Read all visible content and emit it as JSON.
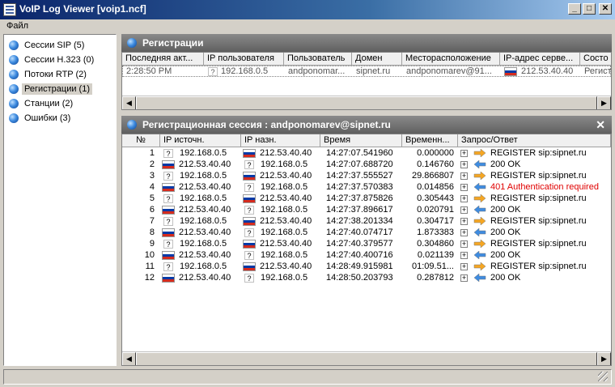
{
  "window": {
    "title": "VoIP Log Viewer [voip1.ncf]"
  },
  "menu": {
    "file": "Файл"
  },
  "sidebar": {
    "items": [
      {
        "label": "Сессии SIP  (5)"
      },
      {
        "label": "Сессии H.323 (0)"
      },
      {
        "label": "Потоки RTP (2)"
      },
      {
        "label": "Регистрации (1)"
      },
      {
        "label": "Станции (2)"
      },
      {
        "label": "Ошибки (3)"
      }
    ],
    "selected_index": 3
  },
  "registrations": {
    "title": "Регистрации",
    "columns": [
      "Последняя акт...",
      "IP пользователя",
      "Пользователь",
      "Домен",
      "Месторасположение",
      "IP-адрес серве...",
      "Состо"
    ],
    "row": {
      "time": "2:28:50 PM",
      "user_ip": "192.168.0.5",
      "user": "andponomar...",
      "domain": "sipnet.ru",
      "location": "andponomarev@91...",
      "server_ip": "212.53.40.40",
      "state": "Регист"
    }
  },
  "session": {
    "title": "Регистрационная сессия : andponomarev@sipnet.ru",
    "columns": [
      "№",
      "IP источн.",
      "IP назн.",
      "Время",
      "Временн...",
      "Запрос/Ответ"
    ],
    "rows": [
      {
        "n": "1",
        "src": "192.168.0.5",
        "src_flag": false,
        "dst": "212.53.40.40",
        "dst_flag": true,
        "time": "14:27:07.541960",
        "delta": "0.000000",
        "dir": "request",
        "msg": "REGISTER sip:sipnet.ru",
        "error": false
      },
      {
        "n": "2",
        "src": "212.53.40.40",
        "src_flag": true,
        "dst": "192.168.0.5",
        "dst_flag": false,
        "time": "14:27:07.688720",
        "delta": "0.146760",
        "dir": "response",
        "msg": "200 OK",
        "error": false
      },
      {
        "n": "3",
        "src": "192.168.0.5",
        "src_flag": false,
        "dst": "212.53.40.40",
        "dst_flag": true,
        "time": "14:27:37.555527",
        "delta": "29.866807",
        "dir": "request",
        "msg": "REGISTER sip:sipnet.ru",
        "error": false
      },
      {
        "n": "4",
        "src": "212.53.40.40",
        "src_flag": true,
        "dst": "192.168.0.5",
        "dst_flag": false,
        "time": "14:27:37.570383",
        "delta": "0.014856",
        "dir": "response",
        "msg": "401 Authentication required",
        "error": true
      },
      {
        "n": "5",
        "src": "192.168.0.5",
        "src_flag": false,
        "dst": "212.53.40.40",
        "dst_flag": true,
        "time": "14:27:37.875826",
        "delta": "0.305443",
        "dir": "request",
        "msg": "REGISTER sip:sipnet.ru",
        "error": false
      },
      {
        "n": "6",
        "src": "212.53.40.40",
        "src_flag": true,
        "dst": "192.168.0.5",
        "dst_flag": false,
        "time": "14:27:37.896617",
        "delta": "0.020791",
        "dir": "response",
        "msg": "200 OK",
        "error": false
      },
      {
        "n": "7",
        "src": "192.168.0.5",
        "src_flag": false,
        "dst": "212.53.40.40",
        "dst_flag": true,
        "time": "14:27:38.201334",
        "delta": "0.304717",
        "dir": "request",
        "msg": "REGISTER sip:sipnet.ru",
        "error": false
      },
      {
        "n": "8",
        "src": "212.53.40.40",
        "src_flag": true,
        "dst": "192.168.0.5",
        "dst_flag": false,
        "time": "14:27:40.074717",
        "delta": "1.873383",
        "dir": "response",
        "msg": "200 OK",
        "error": false
      },
      {
        "n": "9",
        "src": "192.168.0.5",
        "src_flag": false,
        "dst": "212.53.40.40",
        "dst_flag": true,
        "time": "14:27:40.379577",
        "delta": "0.304860",
        "dir": "request",
        "msg": "REGISTER sip:sipnet.ru",
        "error": false
      },
      {
        "n": "10",
        "src": "212.53.40.40",
        "src_flag": true,
        "dst": "192.168.0.5",
        "dst_flag": false,
        "time": "14:27:40.400716",
        "delta": "0.021139",
        "dir": "response",
        "msg": "200 OK",
        "error": false
      },
      {
        "n": "11",
        "src": "192.168.0.5",
        "src_flag": false,
        "dst": "212.53.40.40",
        "dst_flag": true,
        "time": "14:28:49.915981",
        "delta": "01:09.51...",
        "dir": "request",
        "msg": "REGISTER sip:sipnet.ru",
        "error": false
      },
      {
        "n": "12",
        "src": "212.53.40.40",
        "src_flag": true,
        "dst": "192.168.0.5",
        "dst_flag": false,
        "time": "14:28:50.203793",
        "delta": "0.287812",
        "dir": "response",
        "msg": "200 OK",
        "error": false
      }
    ]
  },
  "icons": {
    "app": "log-viewer-icon",
    "tree_item": "blue-ball-icon",
    "unknown_flag": "question-flag-icon",
    "ru_flag": "russia-flag-icon",
    "request": "right-arrow-icon",
    "response": "left-arrow-icon",
    "expand": "plus-icon",
    "close": "close-icon"
  },
  "colors": {
    "error_text": "#e00000",
    "request_arrow": "#f5a623",
    "response_arrow": "#3f8ce0"
  }
}
